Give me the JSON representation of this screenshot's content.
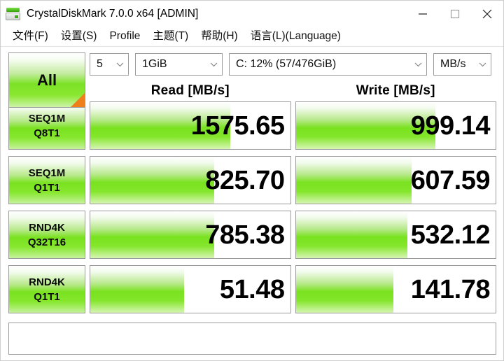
{
  "window": {
    "title": "CrystalDiskMark 7.0.0 x64 [ADMIN]",
    "icon": "disk-drive-icon",
    "controls": {
      "minimize": "minimize-icon",
      "maximize": "maximize-icon",
      "close": "close-icon"
    }
  },
  "menubar": {
    "items": [
      {
        "label": "文件(F)"
      },
      {
        "label": "设置(S)"
      },
      {
        "label": "Profile"
      },
      {
        "label": "主题(T)"
      },
      {
        "label": "帮助(H)"
      },
      {
        "label": "语言(L)(Language)"
      }
    ]
  },
  "toolbar": {
    "all_button_label": "All",
    "run_count": "5",
    "test_size": "1GiB",
    "drive": "C: 12% (57/476GiB)",
    "unit": "MB/s"
  },
  "columns": {
    "read_header": "Read [MB/s]",
    "write_header": "Write [MB/s]"
  },
  "results": [
    {
      "test_line1": "SEQ1M",
      "test_line2": "Q8T1",
      "read": "1575.65",
      "write": "999.14",
      "read_fill_pct": 70,
      "write_fill_pct": 70
    },
    {
      "test_line1": "SEQ1M",
      "test_line2": "Q1T1",
      "read": "825.70",
      "write": "607.59",
      "read_fill_pct": 62,
      "write_fill_pct": 58
    },
    {
      "test_line1": "RND4K",
      "test_line2": "Q32T16",
      "read": "785.38",
      "write": "532.12",
      "read_fill_pct": 62,
      "write_fill_pct": 56
    },
    {
      "test_line1": "RND4K",
      "test_line2": "Q1T1",
      "read": "51.48",
      "write": "141.78",
      "read_fill_pct": 47,
      "write_fill_pct": 49
    }
  ],
  "statusbar": {
    "text": ""
  },
  "colors": {
    "bar_green": "#79e21f",
    "accent_orange": "#ef7f1a",
    "border": "#9b9b9b"
  }
}
